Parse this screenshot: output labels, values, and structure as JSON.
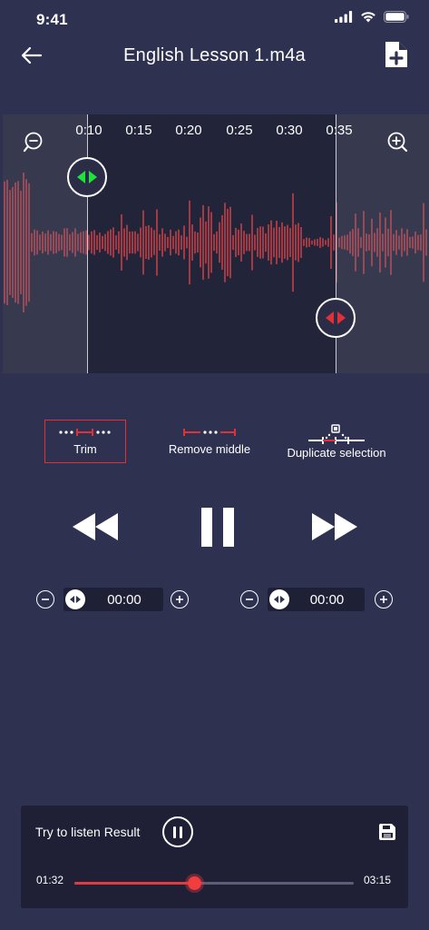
{
  "status_bar": {
    "time": "9:41",
    "icons": [
      "cellular-signal-icon",
      "wifi-icon",
      "battery-icon"
    ]
  },
  "header": {
    "title": "English Lesson 1.m4a",
    "back_icon": "arrow-left-icon",
    "action_icon": "add-file-icon"
  },
  "waveform": {
    "timeline": [
      "0:10",
      "0:15",
      "0:20",
      "0:25",
      "0:30",
      "0:35"
    ],
    "zoom_out_icon": "zoom-out-icon",
    "zoom_in_icon": "zoom-in-icon",
    "start_handle_color": "#1fe23b",
    "end_handle_color": "#e0303a",
    "wave_color": "#e8474b"
  },
  "tools": [
    {
      "label": "Trim",
      "icon": "trim-icon",
      "active": true
    },
    {
      "label": "Remove middle",
      "icon": "remove-middle-icon",
      "active": false
    },
    {
      "label": "Duplicate selection",
      "icon": "duplicate-selection-icon",
      "active": false
    }
  ],
  "transport": {
    "rewind_icon": "rewind-icon",
    "pause_icon": "pause-icon",
    "forward_icon": "fast-forward-icon"
  },
  "start_time": {
    "value": "00:00"
  },
  "end_time": {
    "value": "00:00"
  },
  "result": {
    "label": "Try to listen Result",
    "current": "01:32",
    "total": "03:15",
    "progress": 0.43,
    "accent": "#e23a3e"
  }
}
